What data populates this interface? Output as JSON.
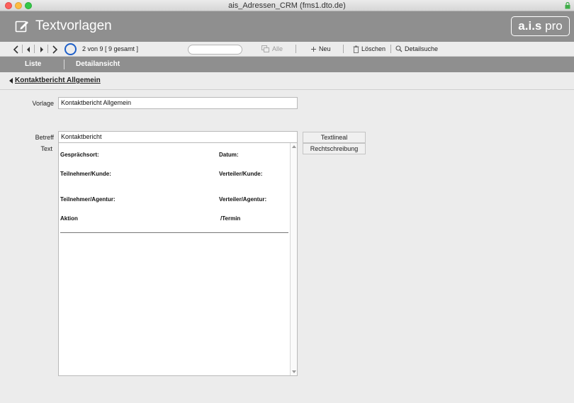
{
  "window": {
    "title": "ais_Adressen_CRM (fms1.dto.de)"
  },
  "header": {
    "title": "Textvorlagen",
    "brand_main": "a.i.s",
    "brand_suffix": " pro"
  },
  "toolbar": {
    "record_status": "2 von 9  [ 9 gesamt ]",
    "all_label": "Alle",
    "new_label": "Neu",
    "delete_label": "Löschen",
    "detail_search_label": "Detailsuche",
    "icons": [
      "first-record-icon",
      "prev-record-icon",
      "next-record-icon",
      "last-record-icon",
      "record-circle-icon",
      "copy-icon",
      "plus-icon",
      "trash-icon",
      "magnifier-icon"
    ]
  },
  "tabs": {
    "list": "Liste",
    "detail": "Detailansicht"
  },
  "content": {
    "back_link": "Kontaktbericht Allgemein",
    "vorlage_label": "Vorlage",
    "vorlage_value": "Kontaktbericht Allgemein",
    "betreff_label": "Betreff",
    "betreff_value": "Kontaktbericht",
    "text_label": "Text",
    "textlineal_button": "Textlineal",
    "rechtschreibung_button": "Rechtschreibung",
    "text_body": {
      "gespraechsort": "Gesprächsort:",
      "datum": "Datum:",
      "teilnehmer_kunde": "Teilnehmer/Kunde:",
      "verteiler_kunde": "Verteiler/Kunde:",
      "teilnehmer_agentur": "Teilnehmer/Agentur:",
      "verteiler_agentur": "Verteiler/Agentur:",
      "aktion": "Aktion",
      "termin": "/Termin"
    }
  },
  "colors": {
    "header_bg": "#8f8f8f",
    "accent_circle": "#1e5fc8"
  }
}
